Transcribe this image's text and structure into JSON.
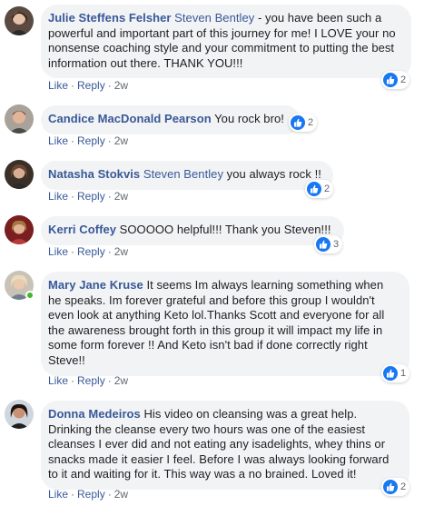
{
  "colors": {
    "link": "#385898",
    "bubble": "#f2f3f5",
    "like_blue": "#1877f2",
    "online_green": "#42b72a"
  },
  "icons": {
    "reaction": "thumbs-up-icon"
  },
  "comments": [
    {
      "author": "Julie Steffens Felsher",
      "tag": "Steven Bentley",
      "text": " - you have been such a powerful and important part of this journey for me! I LOVE your no nonsense coaching style and your commitment to putting the best information out there. THANK YOU!!!",
      "reactions": "2",
      "like": "Like",
      "reply": "Reply",
      "sep": "·",
      "time": "2w"
    },
    {
      "author": "Candice MacDonald Pearson",
      "tag": "",
      "text": " You rock bro!",
      "reactions": "2",
      "like": "Like",
      "reply": "Reply",
      "sep": "·",
      "time": "2w"
    },
    {
      "author": "Natasha Stokvis",
      "tag": "Steven Bentley",
      "text": " you always rock !!",
      "reactions": "2",
      "like": "Like",
      "reply": "Reply",
      "sep": "·",
      "time": "2w"
    },
    {
      "author": "Kerri Coffey",
      "tag": "",
      "text": " SOOOOO helpful!!! Thank you Steven!!!",
      "reactions": "3",
      "like": "Like",
      "reply": "Reply",
      "sep": "·",
      "time": "2w"
    },
    {
      "author": "Mary Jane Kruse",
      "tag": "",
      "text": " It seems Im always learning something when he speaks. Im forever grateful and before this group I wouldn't even look at anything Keto lol.Thanks Scott and everyone for all the awareness brought forth in this group it will impact my life in some form forever !! And Keto isn't bad if done correctly right Steve!!",
      "reactions": "1",
      "like": "Like",
      "reply": "Reply",
      "sep": "·",
      "time": "2w"
    },
    {
      "author": "Donna Medeiros",
      "tag": "",
      "text": " His video on cleansing was a great help. Drinking the cleanse every two hours was one of the easiest cleanses I ever did and not eating any isadelights, whey thins or snacks made it easier I feel. Before I was always looking forward to it and waiting for it. This way was a no brained. Loved it!",
      "reactions": "2",
      "like": "Like",
      "reply": "Reply",
      "sep": "·",
      "time": "2w"
    }
  ]
}
